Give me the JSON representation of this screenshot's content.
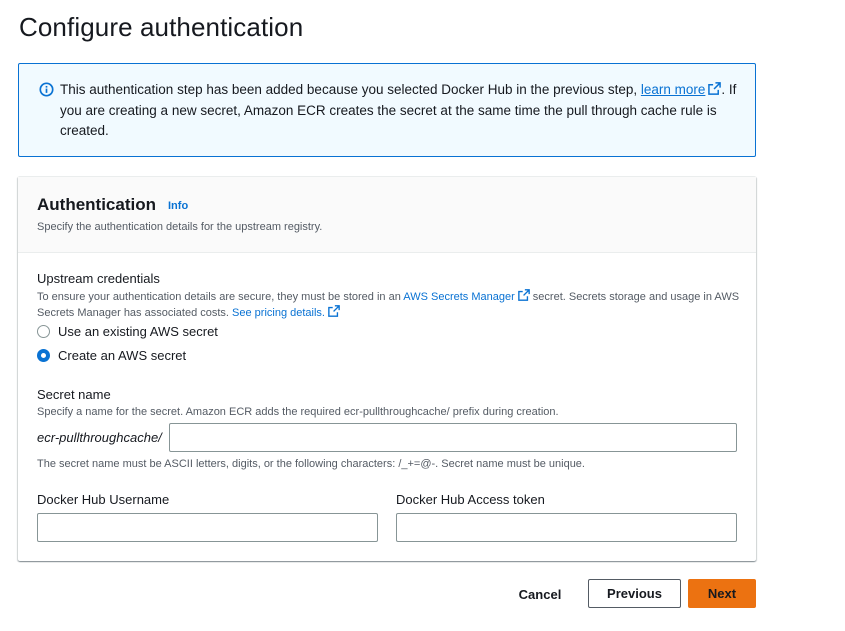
{
  "page": {
    "title": "Configure authentication"
  },
  "alert": {
    "text_before": "This authentication step has been added because you selected Docker Hub in the previous step, ",
    "link": "learn more",
    "text_after": ". If you are creating a new secret, Amazon ECR creates the secret at the same time the pull through cache rule is created.",
    "icon": "info-circle-icon",
    "accent": "#0972d3",
    "background": "#f1faff"
  },
  "panel": {
    "title": "Authentication",
    "info_link": "Info",
    "description": "Specify the authentication details for the upstream registry."
  },
  "credentials": {
    "label": "Upstream credentials",
    "desc_part1": "To ensure your authentication details are secure, they must be stored in an ",
    "desc_link1": "AWS Secrets Manager",
    "desc_part2": " secret. Secrets storage and usage in AWS Secrets Manager has associated costs. ",
    "desc_link2": "See pricing details.",
    "options": [
      {
        "label": "Use an existing AWS secret",
        "selected": false
      },
      {
        "label": "Create an AWS secret",
        "selected": true
      }
    ]
  },
  "secret_name": {
    "label": "Secret name",
    "description": "Specify a name for the secret. Amazon ECR adds the required ecr-pullthroughcache/ prefix during creation.",
    "prefix": "ecr-pullthroughcache/",
    "value": "",
    "constraint": "The secret name must be ASCII letters, digits, or the following characters: /_+=@-. Secret name must be unique."
  },
  "username": {
    "label": "Docker Hub Username",
    "value": ""
  },
  "token": {
    "label": "Docker Hub Access token",
    "value": ""
  },
  "footer": {
    "cancel": "Cancel",
    "previous": "Previous",
    "next": "Next",
    "primary_color": "#ec7211"
  }
}
